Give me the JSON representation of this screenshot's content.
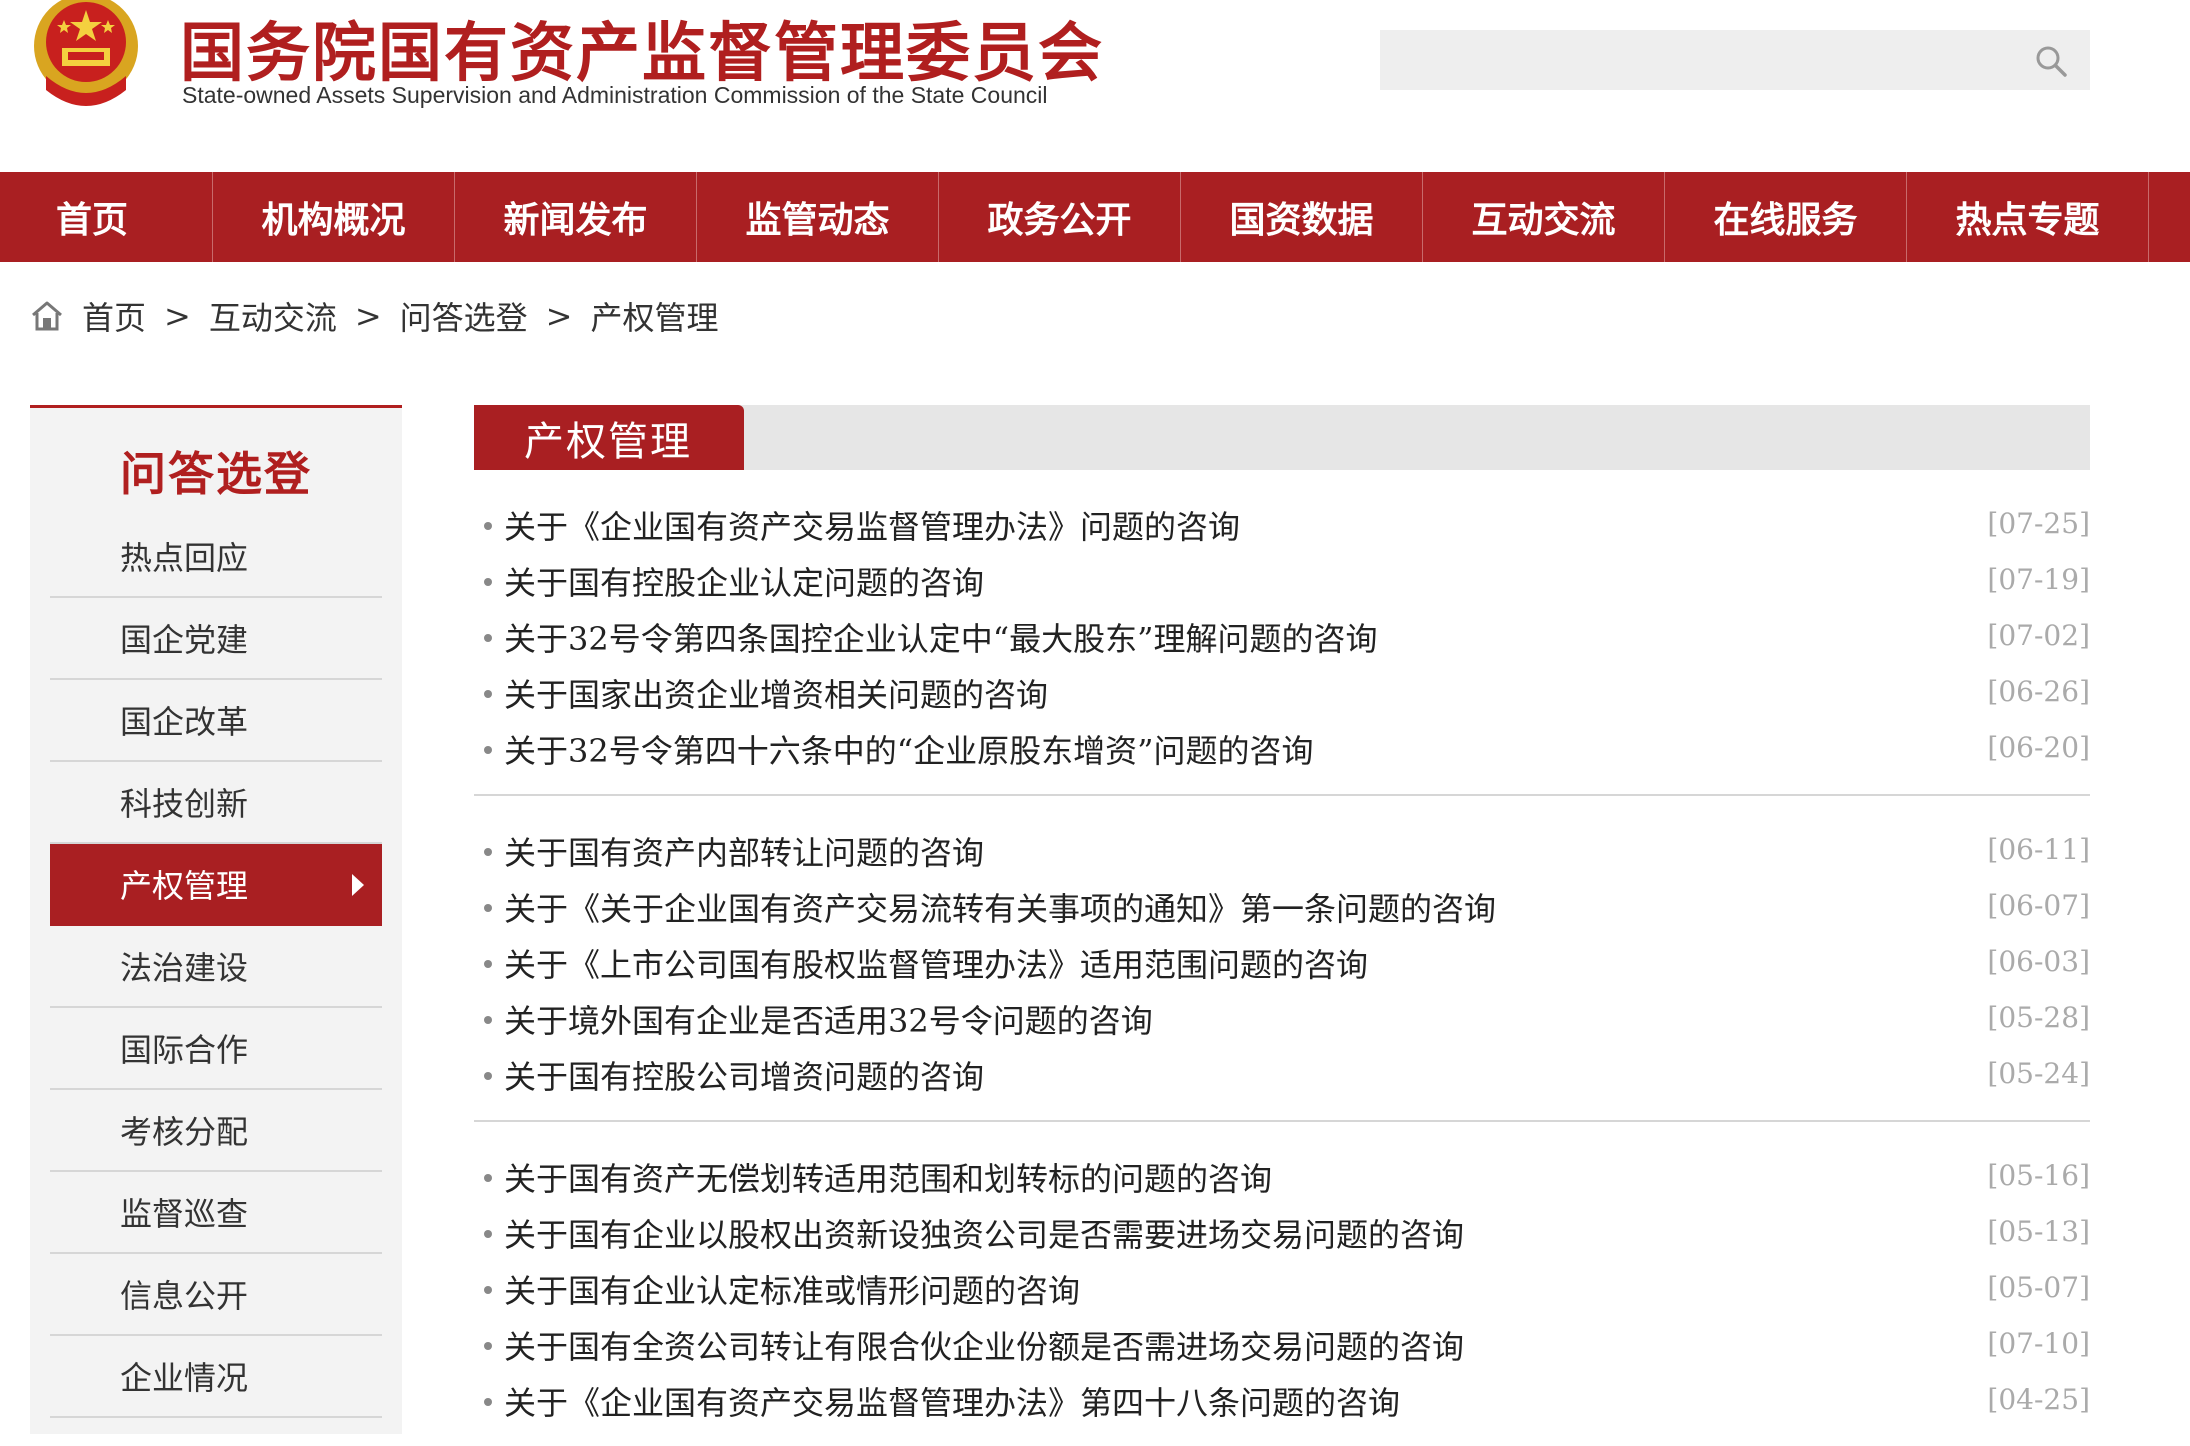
{
  "header": {
    "title": "国务院国有资产监督管理委员会",
    "subtitle": "State-owned Assets Supervision and Administration Commission of the State Council",
    "search_placeholder": "",
    "search_icon": "search-icon",
    "emblem_icon": "national-emblem-icon"
  },
  "colors": {
    "brand_red": "#a91f22",
    "title_red": "#b01f1f",
    "date_gray": "#aaaaaa"
  },
  "nav": {
    "items": [
      {
        "label": "首页"
      },
      {
        "label": "机构概况"
      },
      {
        "label": "新闻发布"
      },
      {
        "label": "监管动态"
      },
      {
        "label": "政务公开"
      },
      {
        "label": "国资数据"
      },
      {
        "label": "互动交流"
      },
      {
        "label": "在线服务"
      },
      {
        "label": "热点专题"
      }
    ]
  },
  "breadcrumb": {
    "items": [
      "首页",
      "互动交流",
      "问答选登",
      "产权管理"
    ],
    "separator": ">"
  },
  "sidebar": {
    "title": "问答选登",
    "items": [
      {
        "label": "热点回应"
      },
      {
        "label": "国企党建"
      },
      {
        "label": "国企改革"
      },
      {
        "label": "科技创新"
      },
      {
        "label": "产权管理",
        "active": true
      },
      {
        "label": "法治建设"
      },
      {
        "label": "国际合作"
      },
      {
        "label": "考核分配"
      },
      {
        "label": "监督巡查"
      },
      {
        "label": "信息公开"
      },
      {
        "label": "企业情况"
      }
    ]
  },
  "main": {
    "section_title": "产权管理",
    "groups": [
      [
        {
          "title": "关于《企业国有资产交易监督管理办法》问题的咨询",
          "date": "[07-25]"
        },
        {
          "title": "关于国有控股企业认定问题的咨询",
          "date": "[07-19]"
        },
        {
          "title": "关于32号令第四条国控企业认定中“最大股东”理解问题的咨询",
          "date": "[07-02]"
        },
        {
          "title": "关于国家出资企业增资相关问题的咨询",
          "date": "[06-26]"
        },
        {
          "title": "关于32号令第四十六条中的“企业原股东增资”问题的咨询",
          "date": "[06-20]"
        }
      ],
      [
        {
          "title": "关于国有资产内部转让问题的咨询",
          "date": "[06-11]"
        },
        {
          "title": "关于《关于企业国有资产交易流转有关事项的通知》第一条问题的咨询",
          "date": "[06-07]"
        },
        {
          "title": "关于《上市公司国有股权监督管理办法》适用范围问题的咨询",
          "date": "[06-03]"
        },
        {
          "title": "关于境外国有企业是否适用32号令问题的咨询",
          "date": "[05-28]"
        },
        {
          "title": "关于国有控股公司增资问题的咨询",
          "date": "[05-24]"
        }
      ],
      [
        {
          "title": "关于国有资产无偿划转适用范围和划转标的问题的咨询",
          "date": "[05-16]"
        },
        {
          "title": "关于国有企业以股权出资新设独资公司是否需要进场交易问题的咨询",
          "date": "[05-13]"
        },
        {
          "title": "关于国有企业认定标准或情形问题的咨询",
          "date": "[05-07]"
        },
        {
          "title": "关于国有全资公司转让有限合伙企业份额是否需进场交易问题的咨询",
          "date": "[07-10]"
        },
        {
          "title": "关于《企业国有资产交易监督管理办法》第四十八条问题的咨询",
          "date": "[04-25]"
        }
      ]
    ]
  }
}
